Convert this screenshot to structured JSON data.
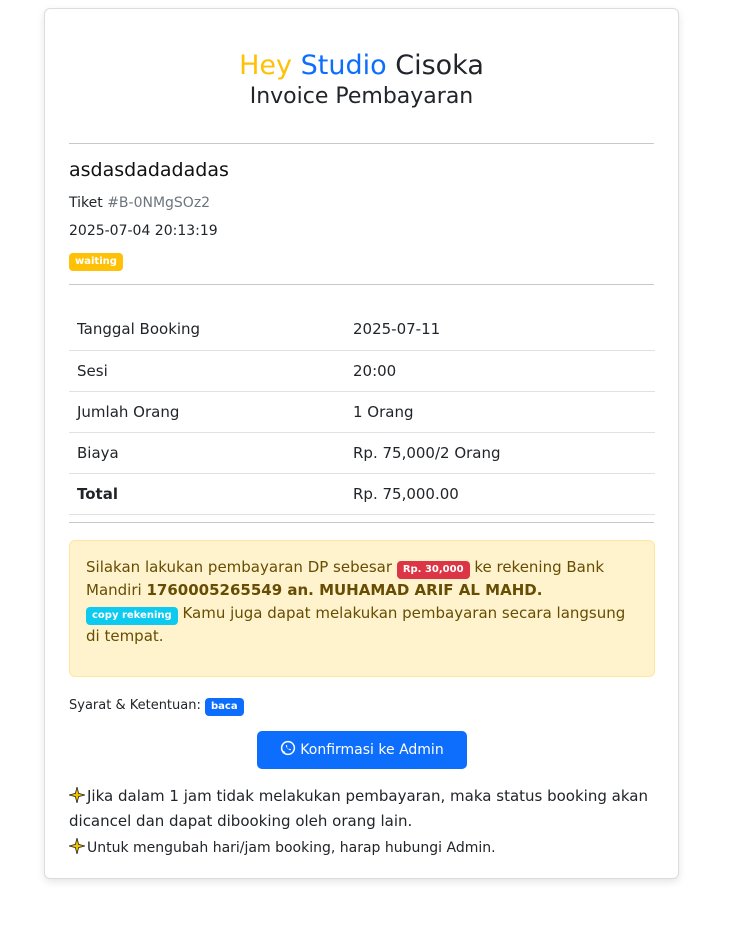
{
  "header": {
    "brand_hey": "Hey",
    "brand_studio": "Studio",
    "brand_city": "Cisoka",
    "subtitle": "Invoice Pembayaran"
  },
  "customer": {
    "name": "asdasdadadadas",
    "ticket_label": "Tiket",
    "ticket_code": "#B-0NMgSOz2",
    "created_at": "2025-07-04 20:13:19",
    "status": "waiting"
  },
  "details": [
    {
      "label": "Tanggal Booking",
      "value": "2025-07-11"
    },
    {
      "label": "Sesi",
      "value": "20:00"
    },
    {
      "label": "Jumlah Orang",
      "value": "1 Orang"
    },
    {
      "label": "Biaya",
      "value": "Rp. 75,000/2 Orang"
    },
    {
      "label": "Total",
      "value": "Rp. 75,000.00"
    }
  ],
  "payment": {
    "text_1": "Silakan lakukan pembayaran DP sebesar",
    "dp_amount": "Rp. 30,000",
    "text_2": "ke rekening Bank Mandiri",
    "account": "1760005265549 an. MUHAMAD ARIF AL MAHD.",
    "copy_label": "copy rekening",
    "text_3": "Kamu juga dapat melakukan pembayaran secara langsung di tempat."
  },
  "terms": {
    "label": "Syarat & Ketentuan:",
    "link": "baca"
  },
  "confirm_button": "Konfirmasi ke Admin",
  "notes": [
    "Jika dalam 1 jam tidak melakukan pembayaran, maka status booking akan dicancel dan dapat dibooking oleh orang lain.",
    "Untuk mengubah hari/jam booking, harap hubungi Admin."
  ],
  "colors": {
    "accent_yellow": "#ffc107",
    "accent_blue": "#0d6efd",
    "danger": "#dc3545",
    "info": "#0dcaf0",
    "alert_bg": "#fff3cd"
  }
}
